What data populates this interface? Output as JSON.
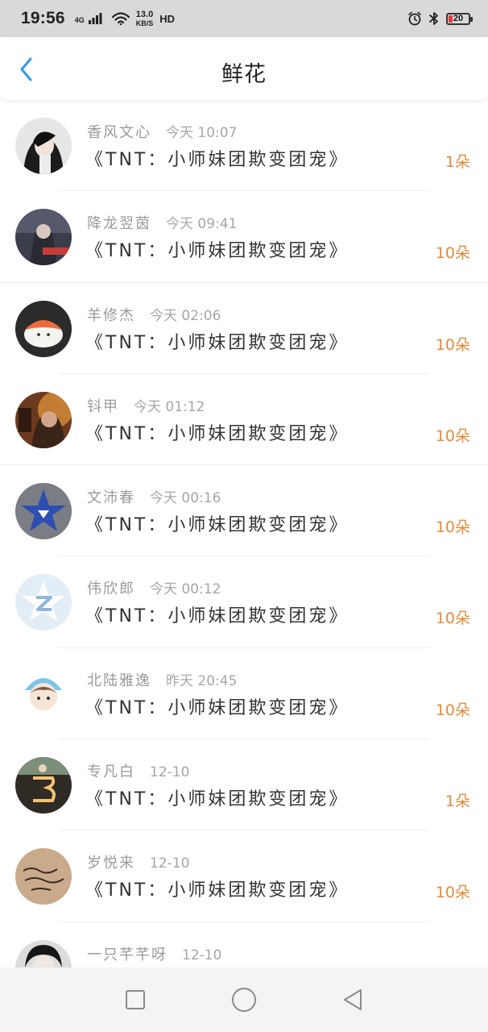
{
  "status_bar": {
    "time": "19:56",
    "network_type": "4G",
    "speed_value": "13.0",
    "speed_unit": "KB/S",
    "hd_label": "HD",
    "battery_level": "20",
    "icons": [
      "signal-icon",
      "wifi-icon",
      "alarm-icon",
      "bluetooth-icon",
      "battery-icon"
    ]
  },
  "header": {
    "title": "鲜花",
    "back_icon": "chevron-left-icon"
  },
  "colors": {
    "accent_blue": "#2f9be9",
    "count_orange": "#e58a3a",
    "name_gray": "#9a9a9a"
  },
  "list": {
    "items": [
      {
        "name": "香风文心",
        "time": "今天 10:07",
        "work": "《TNT：小师妹团欺变团宠》",
        "count": "1朵"
      },
      {
        "name": "降龙翌茵",
        "time": "今天 09:41",
        "work": "《TNT：小师妹团欺变团宠》",
        "count": "10朵"
      },
      {
        "name": "羊修杰",
        "time": "今天 02:06",
        "work": "《TNT：小师妹团欺变团宠》",
        "count": "10朵"
      },
      {
        "name": "钭甲",
        "time": "今天 01:12",
        "work": "《TNT：小师妹团欺变团宠》",
        "count": "10朵"
      },
      {
        "name": "文沛春",
        "time": "今天 00:16",
        "work": "《TNT：小师妹团欺变团宠》",
        "count": "10朵"
      },
      {
        "name": "伟欣郎",
        "time": "今天 00:12",
        "work": "《TNT：小师妹团欺变团宠》",
        "count": "10朵"
      },
      {
        "name": "北陆雅逸",
        "time": "昨天 20:45",
        "work": "《TNT：小师妹团欺变团宠》",
        "count": "10朵"
      },
      {
        "name": "专凡白",
        "time": "12-10",
        "work": "《TNT：小师妹团欺变团宠》",
        "count": "1朵"
      },
      {
        "name": "岁悦来",
        "time": "12-10",
        "work": "《TNT：小师妹团欺变团宠》",
        "count": "10朵"
      },
      {
        "name": "一只芊芊呀",
        "time": "12-10",
        "work": "",
        "count": ""
      }
    ]
  },
  "nav_bar": {
    "buttons": [
      "recents-square-icon",
      "home-circle-icon",
      "back-triangle-icon"
    ]
  }
}
